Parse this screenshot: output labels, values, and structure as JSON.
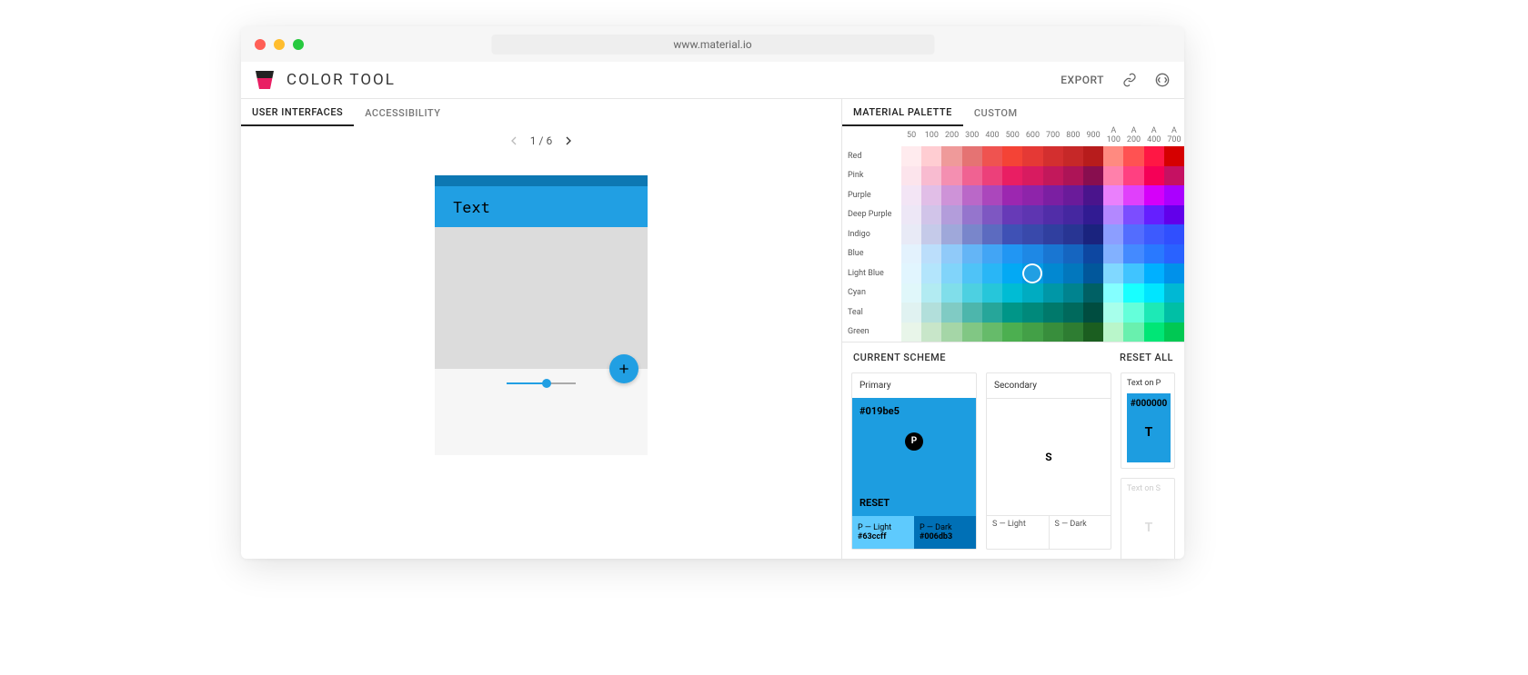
{
  "url": "www.material.io",
  "app_title": "COLOR  TOOL",
  "header": {
    "export": "EXPORT"
  },
  "left_tabs": [
    "USER INTERFACES",
    "ACCESSIBILITY"
  ],
  "left_tabs_active": 0,
  "right_tabs": [
    "MATERIAL PALETTE",
    "CUSTOM"
  ],
  "right_tabs_active": 0,
  "preview": {
    "page_indicator": "1 / 6",
    "appbar_text": "Text",
    "slider_pct": 58
  },
  "shade_labels": [
    "50",
    "100",
    "200",
    "300",
    "400",
    "500",
    "600",
    "700",
    "800",
    "900",
    "A 100",
    "A 200",
    "A 400",
    "A 700"
  ],
  "rows": [
    {
      "name": "Red",
      "shades": [
        "#ffebee",
        "#ffcdd2",
        "#ef9a9a",
        "#e57373",
        "#ef5350",
        "#f44336",
        "#e53935",
        "#d32f2f",
        "#c62828",
        "#b71c1c",
        "#ff8a80",
        "#ff5252",
        "#ff1744",
        "#d50000"
      ]
    },
    {
      "name": "Pink",
      "shades": [
        "#fce4ec",
        "#f8bbd0",
        "#f48fb1",
        "#f06292",
        "#ec407a",
        "#e91e63",
        "#d81b60",
        "#c2185b",
        "#ad1457",
        "#880e4f",
        "#ff80ab",
        "#ff4081",
        "#f50057",
        "#c51162"
      ]
    },
    {
      "name": "Purple",
      "shades": [
        "#f3e5f5",
        "#e1bee7",
        "#ce93d8",
        "#ba68c8",
        "#ab47bc",
        "#9c27b0",
        "#8e24aa",
        "#7b1fa2",
        "#6a1b9a",
        "#4a148c",
        "#ea80fc",
        "#e040fb",
        "#d500f9",
        "#aa00ff"
      ]
    },
    {
      "name": "Deep Purple",
      "shades": [
        "#ede7f6",
        "#d1c4e9",
        "#b39ddb",
        "#9575cd",
        "#7e57c2",
        "#673ab7",
        "#5e35b1",
        "#512da8",
        "#4527a0",
        "#311b92",
        "#b388ff",
        "#7c4dff",
        "#651fff",
        "#6200ea"
      ]
    },
    {
      "name": "Indigo",
      "shades": [
        "#e8eaf6",
        "#c5cae9",
        "#9fa8da",
        "#7986cb",
        "#5c6bc0",
        "#3f51b5",
        "#3949ab",
        "#303f9f",
        "#283593",
        "#1a237e",
        "#8c9eff",
        "#536dfe",
        "#3d5afe",
        "#304ffe"
      ]
    },
    {
      "name": "Blue",
      "shades": [
        "#e3f2fd",
        "#bbdefb",
        "#90caf9",
        "#64b5f6",
        "#42a5f5",
        "#2196f3",
        "#1e88e5",
        "#1976d2",
        "#1565c0",
        "#0d47a1",
        "#82b1ff",
        "#448aff",
        "#2979ff",
        "#2962ff"
      ]
    },
    {
      "name": "Light Blue",
      "shades": [
        "#e1f5fe",
        "#b3e5fc",
        "#81d4fa",
        "#4fc3f7",
        "#29b6f6",
        "#03a9f4",
        "#039be5",
        "#0288d1",
        "#0277bd",
        "#01579b",
        "#80d8ff",
        "#40c4ff",
        "#00b0ff",
        "#0091ea"
      ]
    },
    {
      "name": "Cyan",
      "shades": [
        "#e0f7fa",
        "#b2ebf2",
        "#80deea",
        "#4dd0e1",
        "#26c6da",
        "#00bcd4",
        "#00acc1",
        "#0097a7",
        "#00838f",
        "#006064",
        "#84ffff",
        "#18ffff",
        "#00e5ff",
        "#00b8d4"
      ]
    },
    {
      "name": "Teal",
      "shades": [
        "#e0f2f1",
        "#b2dfdb",
        "#80cbc4",
        "#4db6ac",
        "#26a69a",
        "#009688",
        "#00897b",
        "#00796b",
        "#00695c",
        "#004d40",
        "#a7ffeb",
        "#64ffda",
        "#1de9b6",
        "#00bfa5"
      ]
    },
    {
      "name": "Green",
      "shades": [
        "#e8f5e9",
        "#c8e6c9",
        "#a5d6a7",
        "#81c784",
        "#66bb6a",
        "#4caf50",
        "#43a047",
        "#388e3c",
        "#2e7d32",
        "#1b5e20",
        "#b9f6ca",
        "#69f0ae",
        "#00e676",
        "#00c853"
      ]
    }
  ],
  "selected": {
    "row": 6,
    "col": 6
  },
  "scheme": {
    "title": "CURRENT SCHEME",
    "reset_all": "RESET ALL",
    "primary": {
      "label": "Primary",
      "hex": "#019be5",
      "p_letter": "P",
      "reset": "RESET",
      "light": {
        "label": "P — Light",
        "hex": "#63ccff"
      },
      "dark": {
        "label": "P — Dark",
        "hex": "#006db3"
      }
    },
    "secondary": {
      "label": "Secondary",
      "s_letter": "S",
      "light_label": "S — Light",
      "dark_label": "S — Dark"
    },
    "text_on_p": {
      "label": "Text on P",
      "hex": "#000000",
      "t": "T"
    },
    "text_on_s": {
      "label": "Text on S",
      "t": "T"
    }
  }
}
